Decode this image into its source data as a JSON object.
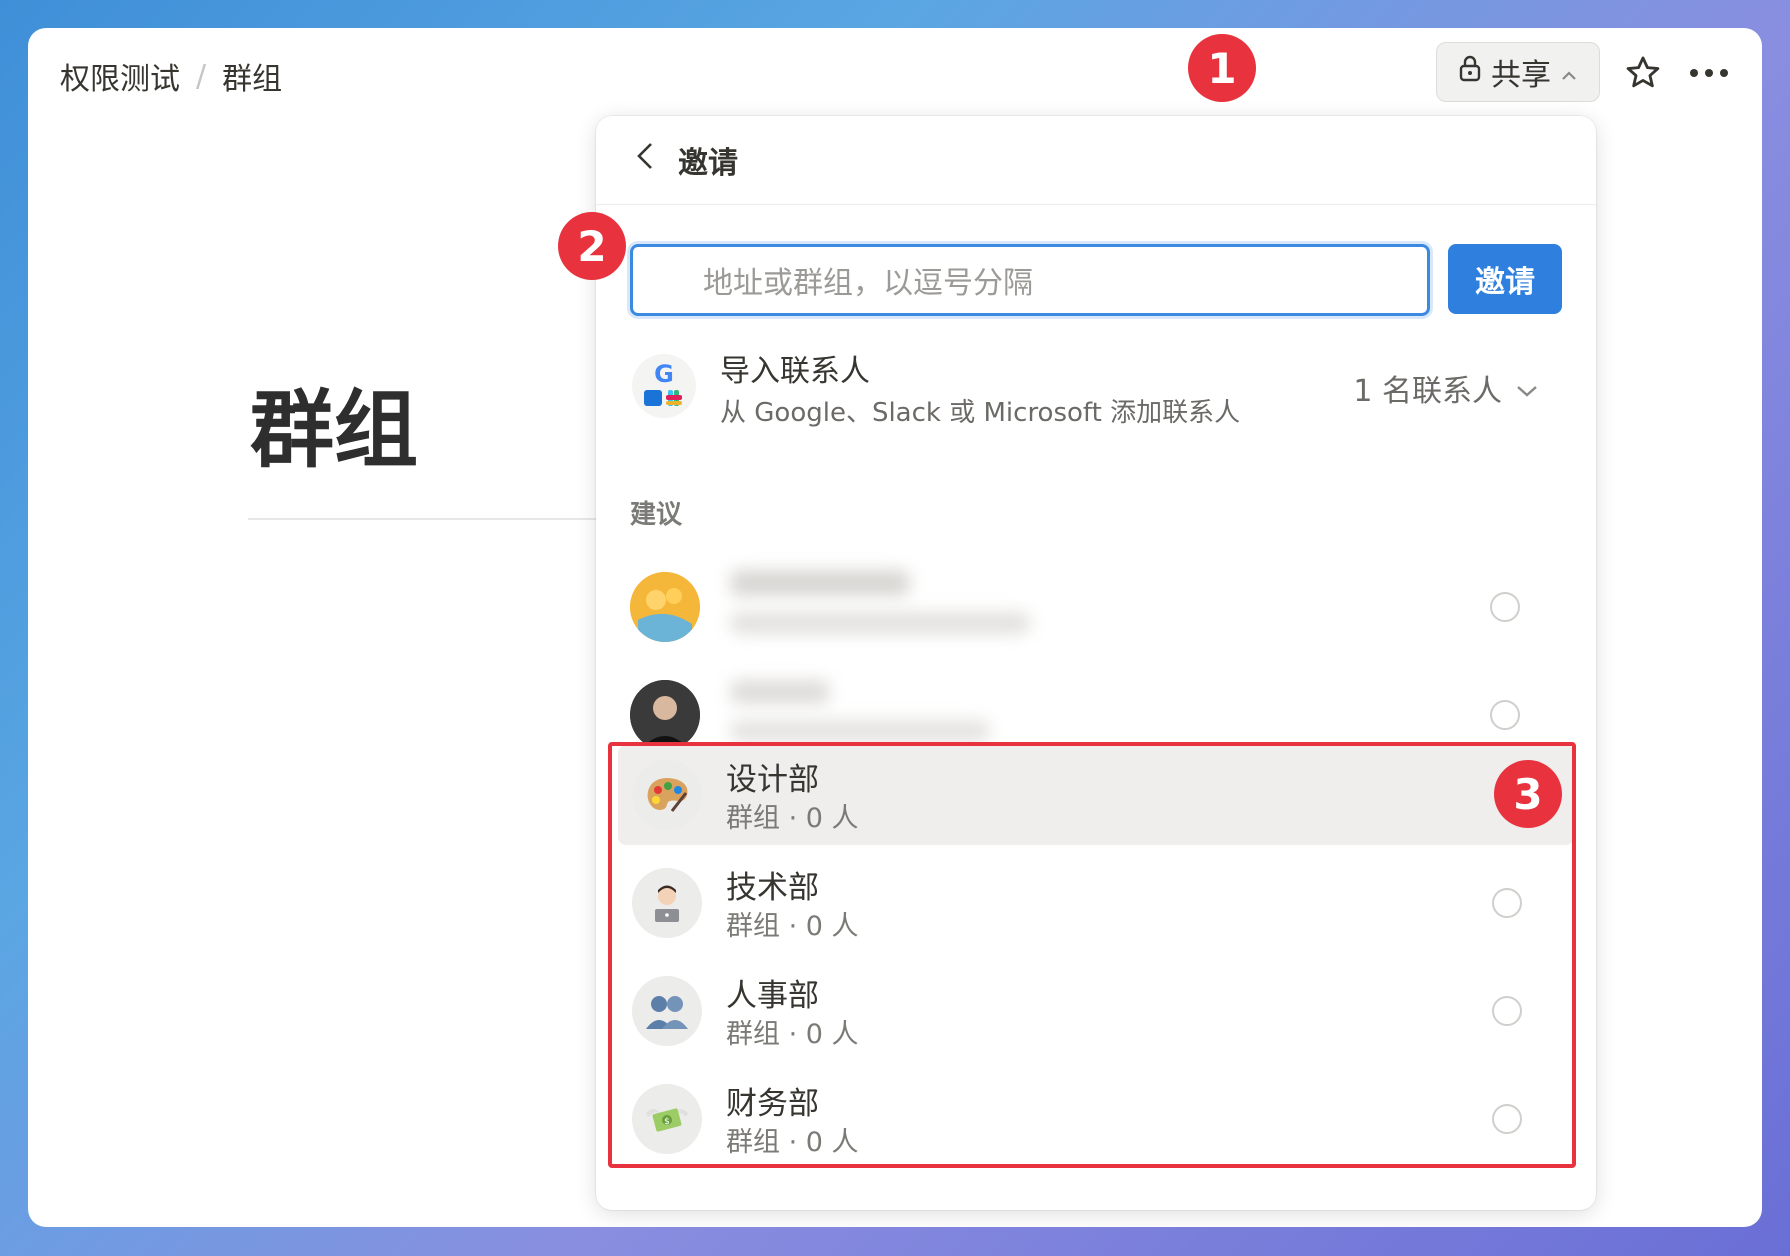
{
  "breadcrumb": {
    "workspace": "权限测试",
    "separator": "/",
    "page": "群组"
  },
  "page": {
    "heading": "群组"
  },
  "topbar": {
    "share_label": "共享"
  },
  "annotations": {
    "badge1": "1",
    "badge2": "2",
    "badge3": "3"
  },
  "panel": {
    "title": "邀请",
    "input_placeholder": "地址或群组，以逗号分隔",
    "invite_button": "邀请",
    "import": {
      "title": "导入联系人",
      "subtitle": "从 Google、Slack 或 Microsoft 添加联系人",
      "count": "1 名联系人"
    },
    "suggestions_label": "建议",
    "groups": [
      {
        "name": "设计部",
        "meta": "群组 · 0 人",
        "icon": "palette-icon"
      },
      {
        "name": "技术部",
        "meta": "群组 · 0 人",
        "icon": "technologist-icon"
      },
      {
        "name": "人事部",
        "meta": "群组 · 0 人",
        "icon": "people-icon"
      },
      {
        "name": "财务部",
        "meta": "群组 · 0 人",
        "icon": "money-wings-icon"
      }
    ]
  },
  "colors": {
    "accent_blue": "#2f7fde",
    "annotation_red": "#e8323e"
  }
}
